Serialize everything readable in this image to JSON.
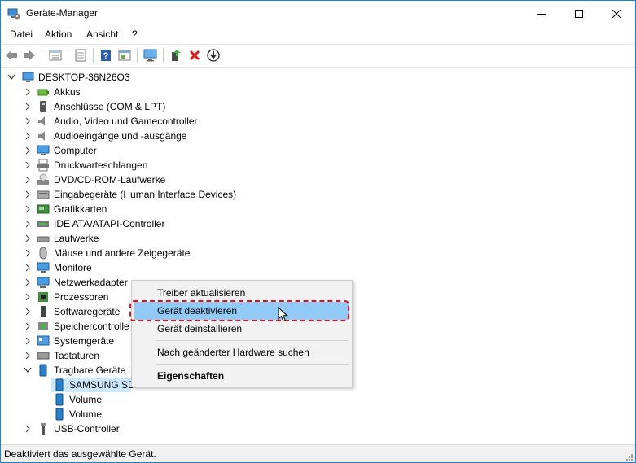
{
  "window": {
    "title": "Geräte-Manager"
  },
  "menu": [
    "Datei",
    "Aktion",
    "Ansicht",
    "?"
  ],
  "tree": {
    "root": "DESKTOP-36N26O3",
    "categories": [
      "Akkus",
      "Anschlüsse (COM & LPT)",
      "Audio, Video und Gamecontroller",
      "Audioeingänge und -ausgänge",
      "Computer",
      "Druckwarteschlangen",
      "DVD/CD-ROM-Laufwerke",
      "Eingabegeräte (Human Interface Devices)",
      "Grafikkarten",
      "IDE ATA/ATAPI-Controller",
      "Laufwerke",
      "Mäuse und andere Zeigegeräte",
      "Monitore",
      "Netzwerkadapter",
      "Prozessoren",
      "Softwaregeräte",
      "Speichercontrolle",
      "Systemgeräte",
      "Tastaturen",
      "Tragbare Geräte"
    ],
    "children": [
      "SAMSUNG SD",
      "Volume",
      "Volume"
    ],
    "last": "USB-Controller"
  },
  "context_menu": {
    "items": [
      "Treiber aktualisieren",
      "Gerät deaktivieren",
      "Gerät deinstallieren",
      "Nach geänderter Hardware suchen",
      "Eigenschaften"
    ],
    "highlighted": "Gerät deaktivieren"
  },
  "status": "Deaktiviert das ausgewählte Gerät.",
  "colors": {
    "selection": "#cce8ff",
    "menu_highlight": "#91c9f7",
    "annotation": "#e0101a"
  }
}
